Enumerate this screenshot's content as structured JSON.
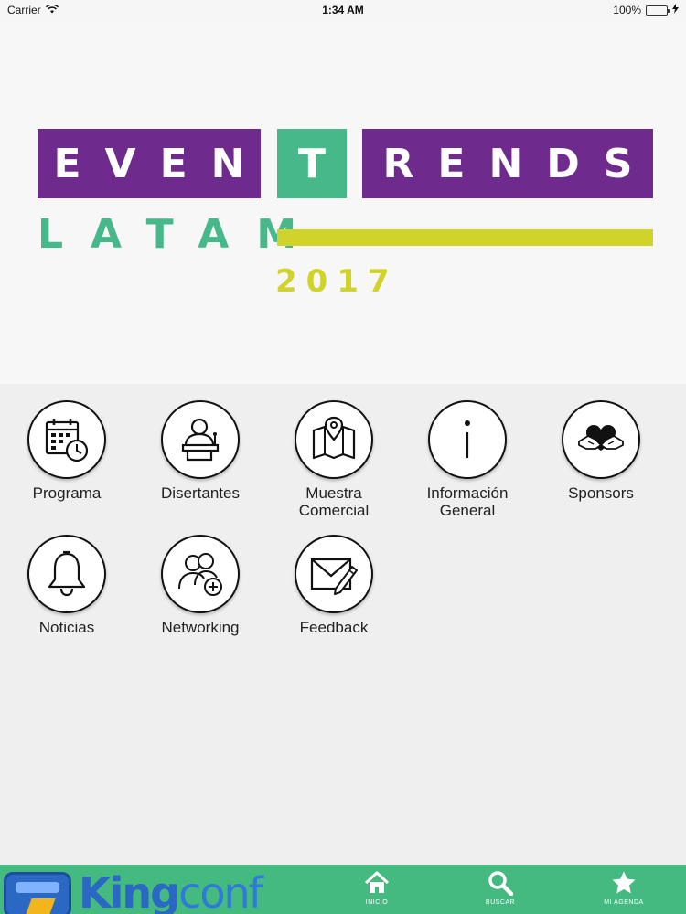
{
  "status_bar": {
    "carrier": "Carrier",
    "time": "1:34 AM",
    "battery": "100%",
    "battery_level": 1.0
  },
  "logo": {
    "part1": "EVEN",
    "part2": "T",
    "part3": "RENDS",
    "part4": "LATAM",
    "year": "2017",
    "colors": {
      "purple": "#6e2a8c",
      "green": "#46b88a",
      "yellow": "#cfd32a"
    }
  },
  "menu": {
    "items": [
      {
        "label": "Programa",
        "icon": "calendar-clock-icon"
      },
      {
        "label": "Disertantes",
        "icon": "speaker-podium-icon"
      },
      {
        "label": "Muestra\nComercial",
        "icon": "map-pin-icon"
      },
      {
        "label": "Información\nGeneral",
        "icon": "info-icon"
      },
      {
        "label": "Sponsors",
        "icon": "hands-heart-icon"
      },
      {
        "label": "Noticias",
        "icon": "bell-icon"
      },
      {
        "label": "Networking",
        "icon": "users-add-icon"
      },
      {
        "label": "Feedback",
        "icon": "envelope-pencil-icon"
      }
    ]
  },
  "tab_bar": {
    "brand": {
      "bold": "King",
      "thin": "conf"
    },
    "tabs": [
      {
        "label": "INICIO",
        "icon": "home-icon"
      },
      {
        "label": "BUSCAR",
        "icon": "search-icon"
      },
      {
        "label": "MI AGENDA",
        "icon": "star-icon"
      }
    ],
    "color": "#45ba80"
  }
}
